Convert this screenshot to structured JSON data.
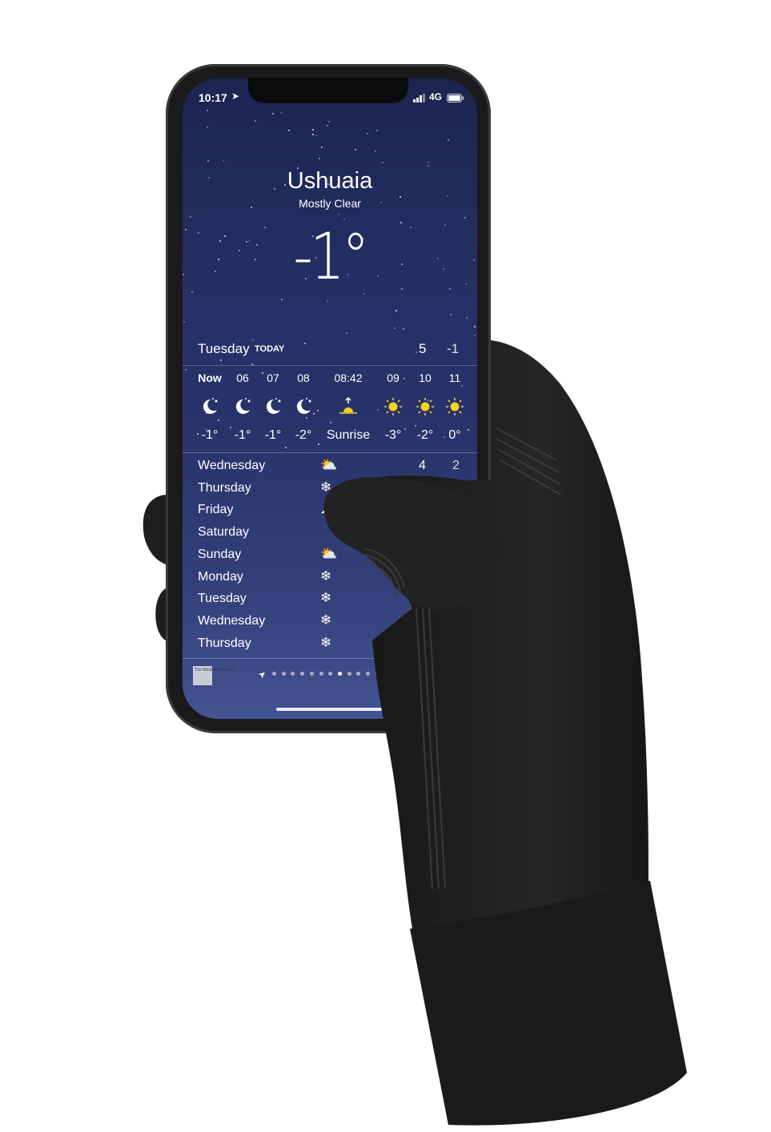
{
  "status_bar": {
    "time": "10:17",
    "location_icon": "location-arrow-icon",
    "network": "4G",
    "signal_icon": "signal-bars-icon",
    "battery_icon": "battery-icon"
  },
  "weather": {
    "city": "Ushuaia",
    "condition": "Mostly Clear",
    "temperature": "-1°",
    "today": {
      "day": "Tuesday",
      "label": "TODAY",
      "high": "5",
      "low": "-1"
    },
    "hourly": [
      {
        "time": "Now",
        "icon": "moon-stars-icon",
        "temp": "-1°"
      },
      {
        "time": "06",
        "icon": "moon-stars-icon",
        "temp": "-1°"
      },
      {
        "time": "07",
        "icon": "moon-stars-icon",
        "temp": "-1°"
      },
      {
        "time": "08",
        "icon": "moon-stars-icon",
        "temp": "-2°"
      },
      {
        "time": "08:42",
        "icon": "sunrise-icon",
        "temp": "Sunrise"
      },
      {
        "time": "09",
        "icon": "sun-icon",
        "temp": "-3°"
      },
      {
        "time": "10",
        "icon": "sun-icon",
        "temp": "-2°"
      },
      {
        "time": "11",
        "icon": "sun-icon",
        "temp": "0°"
      }
    ],
    "daily": [
      {
        "day": "Wednesday",
        "icon": "partly-cloudy-icon",
        "high": "4",
        "low": "2"
      },
      {
        "day": "Thursday",
        "icon": "snowflake-icon"
      },
      {
        "day": "Friday",
        "icon": "cloud-rain-icon"
      },
      {
        "day": "Saturday",
        "icon": ""
      },
      {
        "day": "Sunday",
        "icon": "partly-cloudy-icon"
      },
      {
        "day": "Monday",
        "icon": "snowflake-icon"
      },
      {
        "day": "Tuesday",
        "icon": "snowflake-icon"
      },
      {
        "day": "Wednesday",
        "icon": "snowflake-icon"
      },
      {
        "day": "Thursday",
        "icon": "snowflake-icon"
      }
    ],
    "footer": {
      "logo": "The Weather Channel",
      "page_count": 14,
      "current_page": 8
    }
  },
  "colors": {
    "sun": "#f5d020",
    "screen_top": "#1c2550",
    "glove": "#1c1c1c"
  }
}
